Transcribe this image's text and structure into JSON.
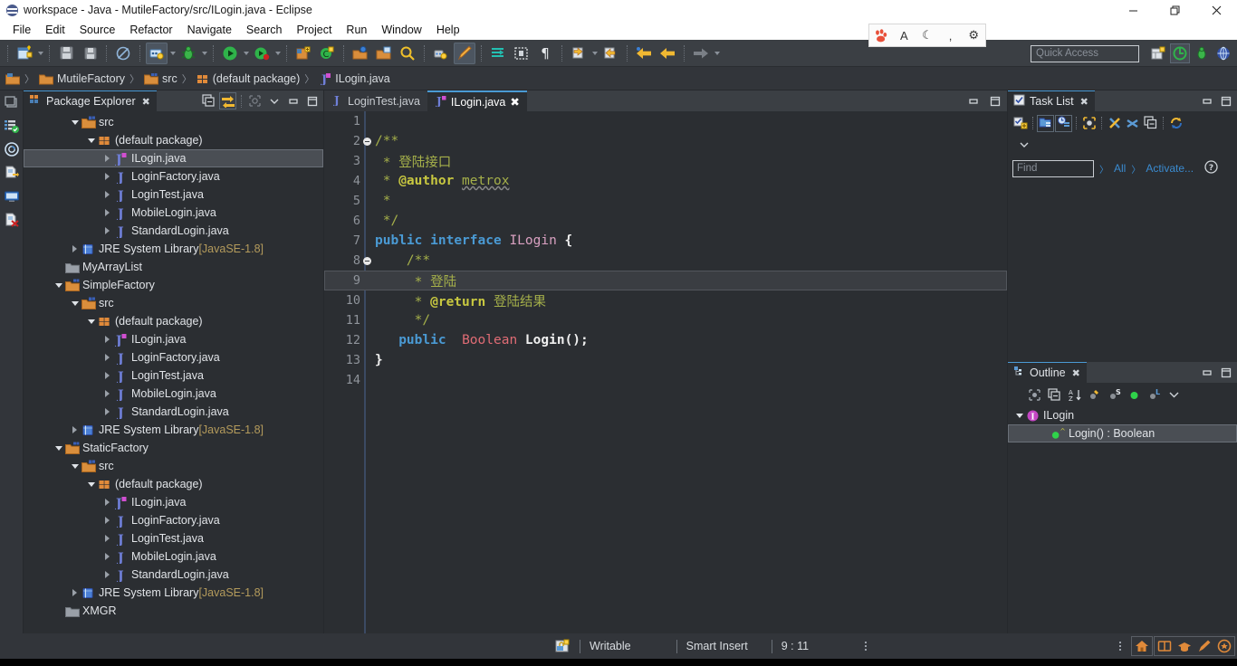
{
  "window": {
    "title": "workspace - Java - MutileFactory/src/ILogin.java - Eclipse",
    "app_icon": "eclipse-icon",
    "controls": {
      "minimize": "minimize-icon",
      "restore": "restore-icon",
      "close": "close-icon"
    }
  },
  "menubar": {
    "items": [
      {
        "label": "File"
      },
      {
        "label": "Edit"
      },
      {
        "label": "Source"
      },
      {
        "label": "Refactor"
      },
      {
        "label": "Navigate"
      },
      {
        "label": "Search"
      },
      {
        "label": "Project"
      },
      {
        "label": "Run"
      },
      {
        "label": "Window"
      },
      {
        "label": "Help"
      }
    ]
  },
  "ime_toolbar": {
    "items": [
      {
        "name": "baidu-ime-icon",
        "glyph": "✿"
      },
      {
        "name": "input-mode-icon",
        "glyph": "A"
      },
      {
        "name": "moon-icon",
        "glyph": "☾"
      },
      {
        "name": "punctuation-icon",
        "glyph": "‚"
      },
      {
        "name": "settings-gear-icon",
        "glyph": "⚙"
      }
    ]
  },
  "toolbar": {
    "quick_access_placeholder": "Quick Access",
    "buttons": [
      {
        "name": "new-wizard-icon"
      },
      {
        "name": "save-icon"
      },
      {
        "name": "save-all-icon"
      },
      {
        "name": "skip-breakpoints-icon"
      },
      {
        "name": "external-tools-icon"
      },
      {
        "name": "debug-icon"
      },
      {
        "name": "run-icon"
      },
      {
        "name": "coverage-icon"
      },
      {
        "name": "new-java-project-icon"
      },
      {
        "name": "new-java-class-icon"
      },
      {
        "name": "open-type-icon"
      },
      {
        "name": "open-task-icon"
      },
      {
        "name": "search-icon"
      },
      {
        "name": "last-edit-icon"
      },
      {
        "name": "edit-pencil-icon"
      },
      {
        "name": "toggle-mark-occurrences-icon"
      },
      {
        "name": "toggle-block-selection-icon"
      },
      {
        "name": "show-whitespace-icon"
      },
      {
        "name": "next-annotation-icon"
      },
      {
        "name": "previous-annotation-icon"
      },
      {
        "name": "back-icon"
      },
      {
        "name": "forward-icon"
      }
    ],
    "perspectives": [
      {
        "name": "open-perspective-icon"
      },
      {
        "name": "java-perspective-icon",
        "selected": true
      },
      {
        "name": "debug-perspective-icon"
      },
      {
        "name": "java-ee-perspective-icon"
      }
    ]
  },
  "breadcrumb": {
    "segments": [
      {
        "label": "",
        "icon": "workspace-icon"
      },
      {
        "label": "MutileFactory",
        "icon": "project-icon"
      },
      {
        "label": "src",
        "icon": "source-folder-icon"
      },
      {
        "label": "(default package)",
        "icon": "package-icon"
      },
      {
        "label": "ILogin.java",
        "icon": "java-interface-file-icon"
      }
    ]
  },
  "fastview": {
    "items": [
      {
        "name": "restore-views-icon"
      },
      {
        "name": "problems-view-icon"
      },
      {
        "name": "javadoc-view-icon"
      },
      {
        "name": "declaration-view-icon"
      },
      {
        "name": "console-view-icon"
      },
      {
        "name": "error-log-view-icon"
      }
    ]
  },
  "package_explorer": {
    "title": "Package Explorer",
    "close_glyph": "✖",
    "tools": [
      {
        "name": "collapse-all-icon"
      },
      {
        "name": "link-with-editor-icon",
        "selected": true
      },
      {
        "name": "focus-on-active-task-icon"
      },
      {
        "name": "view-menu-icon"
      },
      {
        "name": "minimize-icon"
      },
      {
        "name": "maximize-icon"
      }
    ],
    "tree": [
      {
        "indent": 2,
        "arrow": "down",
        "icon": "source-folder-icon",
        "label": "src"
      },
      {
        "indent": 3,
        "arrow": "down",
        "icon": "package-icon",
        "label": "(default package)"
      },
      {
        "indent": 4,
        "arrow": "right",
        "icon": "java-interface-icon",
        "label": "ILogin.java",
        "selected": true
      },
      {
        "indent": 4,
        "arrow": "right",
        "icon": "java-class-icon",
        "label": "LoginFactory.java"
      },
      {
        "indent": 4,
        "arrow": "right",
        "icon": "java-class-icon",
        "label": "LoginTest.java"
      },
      {
        "indent": 4,
        "arrow": "right",
        "icon": "java-class-icon",
        "label": "MobileLogin.java"
      },
      {
        "indent": 4,
        "arrow": "right",
        "icon": "java-class-icon",
        "label": "StandardLogin.java"
      },
      {
        "indent": 2,
        "arrow": "right",
        "icon": "jre-library-icon",
        "label": "JRE System Library",
        "suffix": "[JavaSE-1.8]"
      },
      {
        "indent": 1,
        "arrow": "none",
        "icon": "closed-project-icon",
        "label": "MyArrayList"
      },
      {
        "indent": 1,
        "arrow": "down",
        "icon": "java-project-icon",
        "label": "SimpleFactory"
      },
      {
        "indent": 2,
        "arrow": "down",
        "icon": "source-folder-icon",
        "label": "src"
      },
      {
        "indent": 3,
        "arrow": "down",
        "icon": "package-icon",
        "label": "(default package)"
      },
      {
        "indent": 4,
        "arrow": "right",
        "icon": "java-interface-icon",
        "label": "ILogin.java"
      },
      {
        "indent": 4,
        "arrow": "right",
        "icon": "java-class-icon",
        "label": "LoginFactory.java"
      },
      {
        "indent": 4,
        "arrow": "right",
        "icon": "java-class-icon",
        "label": "LoginTest.java"
      },
      {
        "indent": 4,
        "arrow": "right",
        "icon": "java-class-icon",
        "label": "MobileLogin.java"
      },
      {
        "indent": 4,
        "arrow": "right",
        "icon": "java-class-icon",
        "label": "StandardLogin.java"
      },
      {
        "indent": 2,
        "arrow": "right",
        "icon": "jre-library-icon",
        "label": "JRE System Library",
        "suffix": "[JavaSE-1.8]"
      },
      {
        "indent": 1,
        "arrow": "down",
        "icon": "java-project-icon",
        "label": "StaticFactory"
      },
      {
        "indent": 2,
        "arrow": "down",
        "icon": "source-folder-icon",
        "label": "src"
      },
      {
        "indent": 3,
        "arrow": "down",
        "icon": "package-icon",
        "label": "(default package)"
      },
      {
        "indent": 4,
        "arrow": "right",
        "icon": "java-interface-icon",
        "label": "ILogin.java"
      },
      {
        "indent": 4,
        "arrow": "right",
        "icon": "java-class-icon",
        "label": "LoginFactory.java"
      },
      {
        "indent": 4,
        "arrow": "right",
        "icon": "java-class-icon",
        "label": "LoginTest.java"
      },
      {
        "indent": 4,
        "arrow": "right",
        "icon": "java-class-icon",
        "label": "MobileLogin.java"
      },
      {
        "indent": 4,
        "arrow": "right",
        "icon": "java-class-icon",
        "label": "StandardLogin.java"
      },
      {
        "indent": 2,
        "arrow": "right",
        "icon": "jre-library-icon",
        "label": "JRE System Library",
        "suffix": "[JavaSE-1.8]"
      },
      {
        "indent": 1,
        "arrow": "none",
        "icon": "closed-project-icon",
        "label": "XMGR"
      }
    ]
  },
  "editor": {
    "tabs": [
      {
        "label": "LoginTest.java",
        "icon": "java-class-icon",
        "active": false
      },
      {
        "label": "ILogin.java",
        "icon": "java-interface-icon",
        "active": true,
        "close_glyph": "✖"
      }
    ],
    "tools": [
      {
        "name": "minimize-icon"
      },
      {
        "name": "maximize-icon"
      }
    ],
    "current_line": 9,
    "lines": [
      {
        "num": "1",
        "fold": false,
        "tokens": []
      },
      {
        "num": "2",
        "fold": true,
        "tokens": [
          {
            "t": "/**",
            "c": "k-doc"
          }
        ]
      },
      {
        "num": "3",
        "fold": false,
        "tokens": [
          {
            "t": " * ",
            "c": "k-doc"
          },
          {
            "t": "登陆接口",
            "c": "k-doc"
          }
        ]
      },
      {
        "num": "4",
        "fold": false,
        "tokens": [
          {
            "t": " * ",
            "c": "k-doc"
          },
          {
            "t": "@author",
            "c": "k-tag"
          },
          {
            "t": " ",
            "c": "k-doc"
          },
          {
            "t": "metrox",
            "c": "k-doc k-under"
          }
        ]
      },
      {
        "num": "5",
        "fold": false,
        "tokens": [
          {
            "t": " * ",
            "c": "k-doc"
          }
        ]
      },
      {
        "num": "6",
        "fold": false,
        "tokens": [
          {
            "t": " */",
            "c": "k-doc"
          }
        ]
      },
      {
        "num": "7",
        "fold": false,
        "tokens": [
          {
            "t": "public",
            "c": "k-kw2"
          },
          {
            "t": " ",
            "c": "k-plain"
          },
          {
            "t": "interface",
            "c": "k-kw2"
          },
          {
            "t": " ",
            "c": "k-plain"
          },
          {
            "t": "ILogin",
            "c": "k-iface"
          },
          {
            "t": " {",
            "c": "k-white"
          }
        ]
      },
      {
        "num": "8",
        "fold": true,
        "tokens": [
          {
            "t": "    /**",
            "c": "k-doc"
          }
        ]
      },
      {
        "num": "9",
        "fold": false,
        "tokens": [
          {
            "t": "     * ",
            "c": "k-doc"
          },
          {
            "t": "登陆",
            "c": "k-doc"
          }
        ]
      },
      {
        "num": "10",
        "fold": false,
        "tokens": [
          {
            "t": "     * ",
            "c": "k-doc"
          },
          {
            "t": "@return",
            "c": "k-tag"
          },
          {
            "t": " ",
            "c": "k-doc"
          },
          {
            "t": "登陆结果",
            "c": "k-doc"
          }
        ]
      },
      {
        "num": "11",
        "fold": false,
        "tokens": [
          {
            "t": "     */",
            "c": "k-doc"
          }
        ]
      },
      {
        "num": "12",
        "fold": false,
        "tokens": [
          {
            "t": "   ",
            "c": "k-plain"
          },
          {
            "t": "public",
            "c": "k-kw2"
          },
          {
            "t": "  ",
            "c": "k-plain"
          },
          {
            "t": "Boolean",
            "c": "k-typer"
          },
          {
            "t": " ",
            "c": "k-plain"
          },
          {
            "t": "Login",
            "c": "k-white"
          },
          {
            "t": "();",
            "c": "k-white"
          }
        ]
      },
      {
        "num": "13",
        "fold": false,
        "tokens": [
          {
            "t": "}",
            "c": "k-white"
          }
        ]
      },
      {
        "num": "14",
        "fold": false,
        "tokens": []
      }
    ]
  },
  "task_list": {
    "title": "Task List",
    "close_glyph": "✖",
    "tools": [
      {
        "name": "new-task-icon"
      },
      {
        "name": "categorize-by-folder-icon",
        "selected": true
      },
      {
        "name": "schedule-icon",
        "selected": true
      },
      {
        "name": "focus-on-workweek-icon"
      },
      {
        "name": "filter-completed-icon"
      },
      {
        "name": "filter-priority-icon"
      },
      {
        "name": "collapse-all-icon"
      },
      {
        "name": "synchronize-changed-icon"
      }
    ],
    "view_menu_glyph": "⌄",
    "find_placeholder": "Find",
    "find_value": "",
    "find_icon": "search-icon",
    "links": [
      {
        "label": "All"
      },
      {
        "label": "Activate..."
      }
    ],
    "help_icon": "help-icon",
    "panel_controls": [
      {
        "name": "minimize-icon"
      },
      {
        "name": "maximize-icon"
      }
    ]
  },
  "outline": {
    "title": "Outline",
    "close_glyph": "✖",
    "tools": [
      {
        "name": "focus-on-active-task-icon"
      },
      {
        "name": "collapse-all-icon"
      },
      {
        "name": "sort-alphabetically-icon"
      },
      {
        "name": "hide-fields-icon"
      },
      {
        "name": "hide-static-icon"
      },
      {
        "name": "hide-non-public-icon"
      },
      {
        "name": "hide-local-types-icon"
      },
      {
        "name": "view-menu-icon"
      }
    ],
    "panel_controls": [
      {
        "name": "minimize-icon"
      },
      {
        "name": "maximize-icon"
      }
    ],
    "tree": [
      {
        "indent": 0,
        "arrow": "down",
        "icon": "interface-icon",
        "label": "ILogin",
        "selected": false
      },
      {
        "indent": 1,
        "arrow": "none",
        "icon": "public-method-icon",
        "label": "Login() : Boolean",
        "selected": true
      }
    ]
  },
  "statusbar": {
    "lock_icon": "writable-lock-icon",
    "writable": "Writable",
    "insert_mode": "Smart Insert",
    "cursor_position": "9 : 11",
    "right_icons": [
      {
        "name": "home-icon"
      },
      {
        "name": "book-icon"
      },
      {
        "name": "graduation-cap-icon"
      },
      {
        "name": "pencil-icon"
      },
      {
        "name": "badge-icon"
      }
    ]
  },
  "colors": {
    "window_bg": "#2f3135",
    "panel_bg": "#2b2e32",
    "toolbar_bg": "#3b3f44",
    "titlebar_bg": "#ffffff",
    "tab_accent": "#4a9ad4",
    "selection": "#4a4e54",
    "comment": "#a5b04a",
    "keyword": "#4a9ad4",
    "type": "#e06c75",
    "link": "#3a8bd0"
  }
}
